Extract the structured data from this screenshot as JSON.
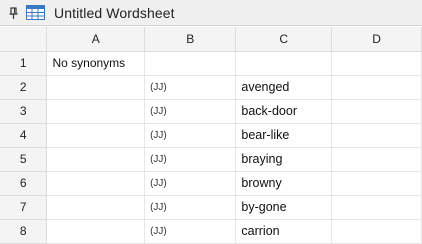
{
  "window": {
    "title": "Untitled Wordsheet",
    "pin_icon": "pin-icon",
    "app_icon": "spreadsheet-icon"
  },
  "columns": [
    "A",
    "B",
    "C",
    "D"
  ],
  "rows": [
    {
      "num": "1",
      "a": "No synonyms",
      "b": "",
      "c": "",
      "d": ""
    },
    {
      "num": "2",
      "a": "",
      "b": "(JJ)",
      "c": "avenged",
      "d": ""
    },
    {
      "num": "3",
      "a": "",
      "b": "(JJ)",
      "c": "back-door",
      "d": ""
    },
    {
      "num": "4",
      "a": "",
      "b": "(JJ)",
      "c": "bear-like",
      "d": ""
    },
    {
      "num": "5",
      "a": "",
      "b": "(JJ)",
      "c": "braying",
      "d": ""
    },
    {
      "num": "6",
      "a": "",
      "b": "(JJ)",
      "c": "browny",
      "d": ""
    },
    {
      "num": "7",
      "a": "",
      "b": "(JJ)",
      "c": "by-gone",
      "d": ""
    },
    {
      "num": "8",
      "a": "",
      "b": "(JJ)",
      "c": "carrion",
      "d": ""
    }
  ]
}
